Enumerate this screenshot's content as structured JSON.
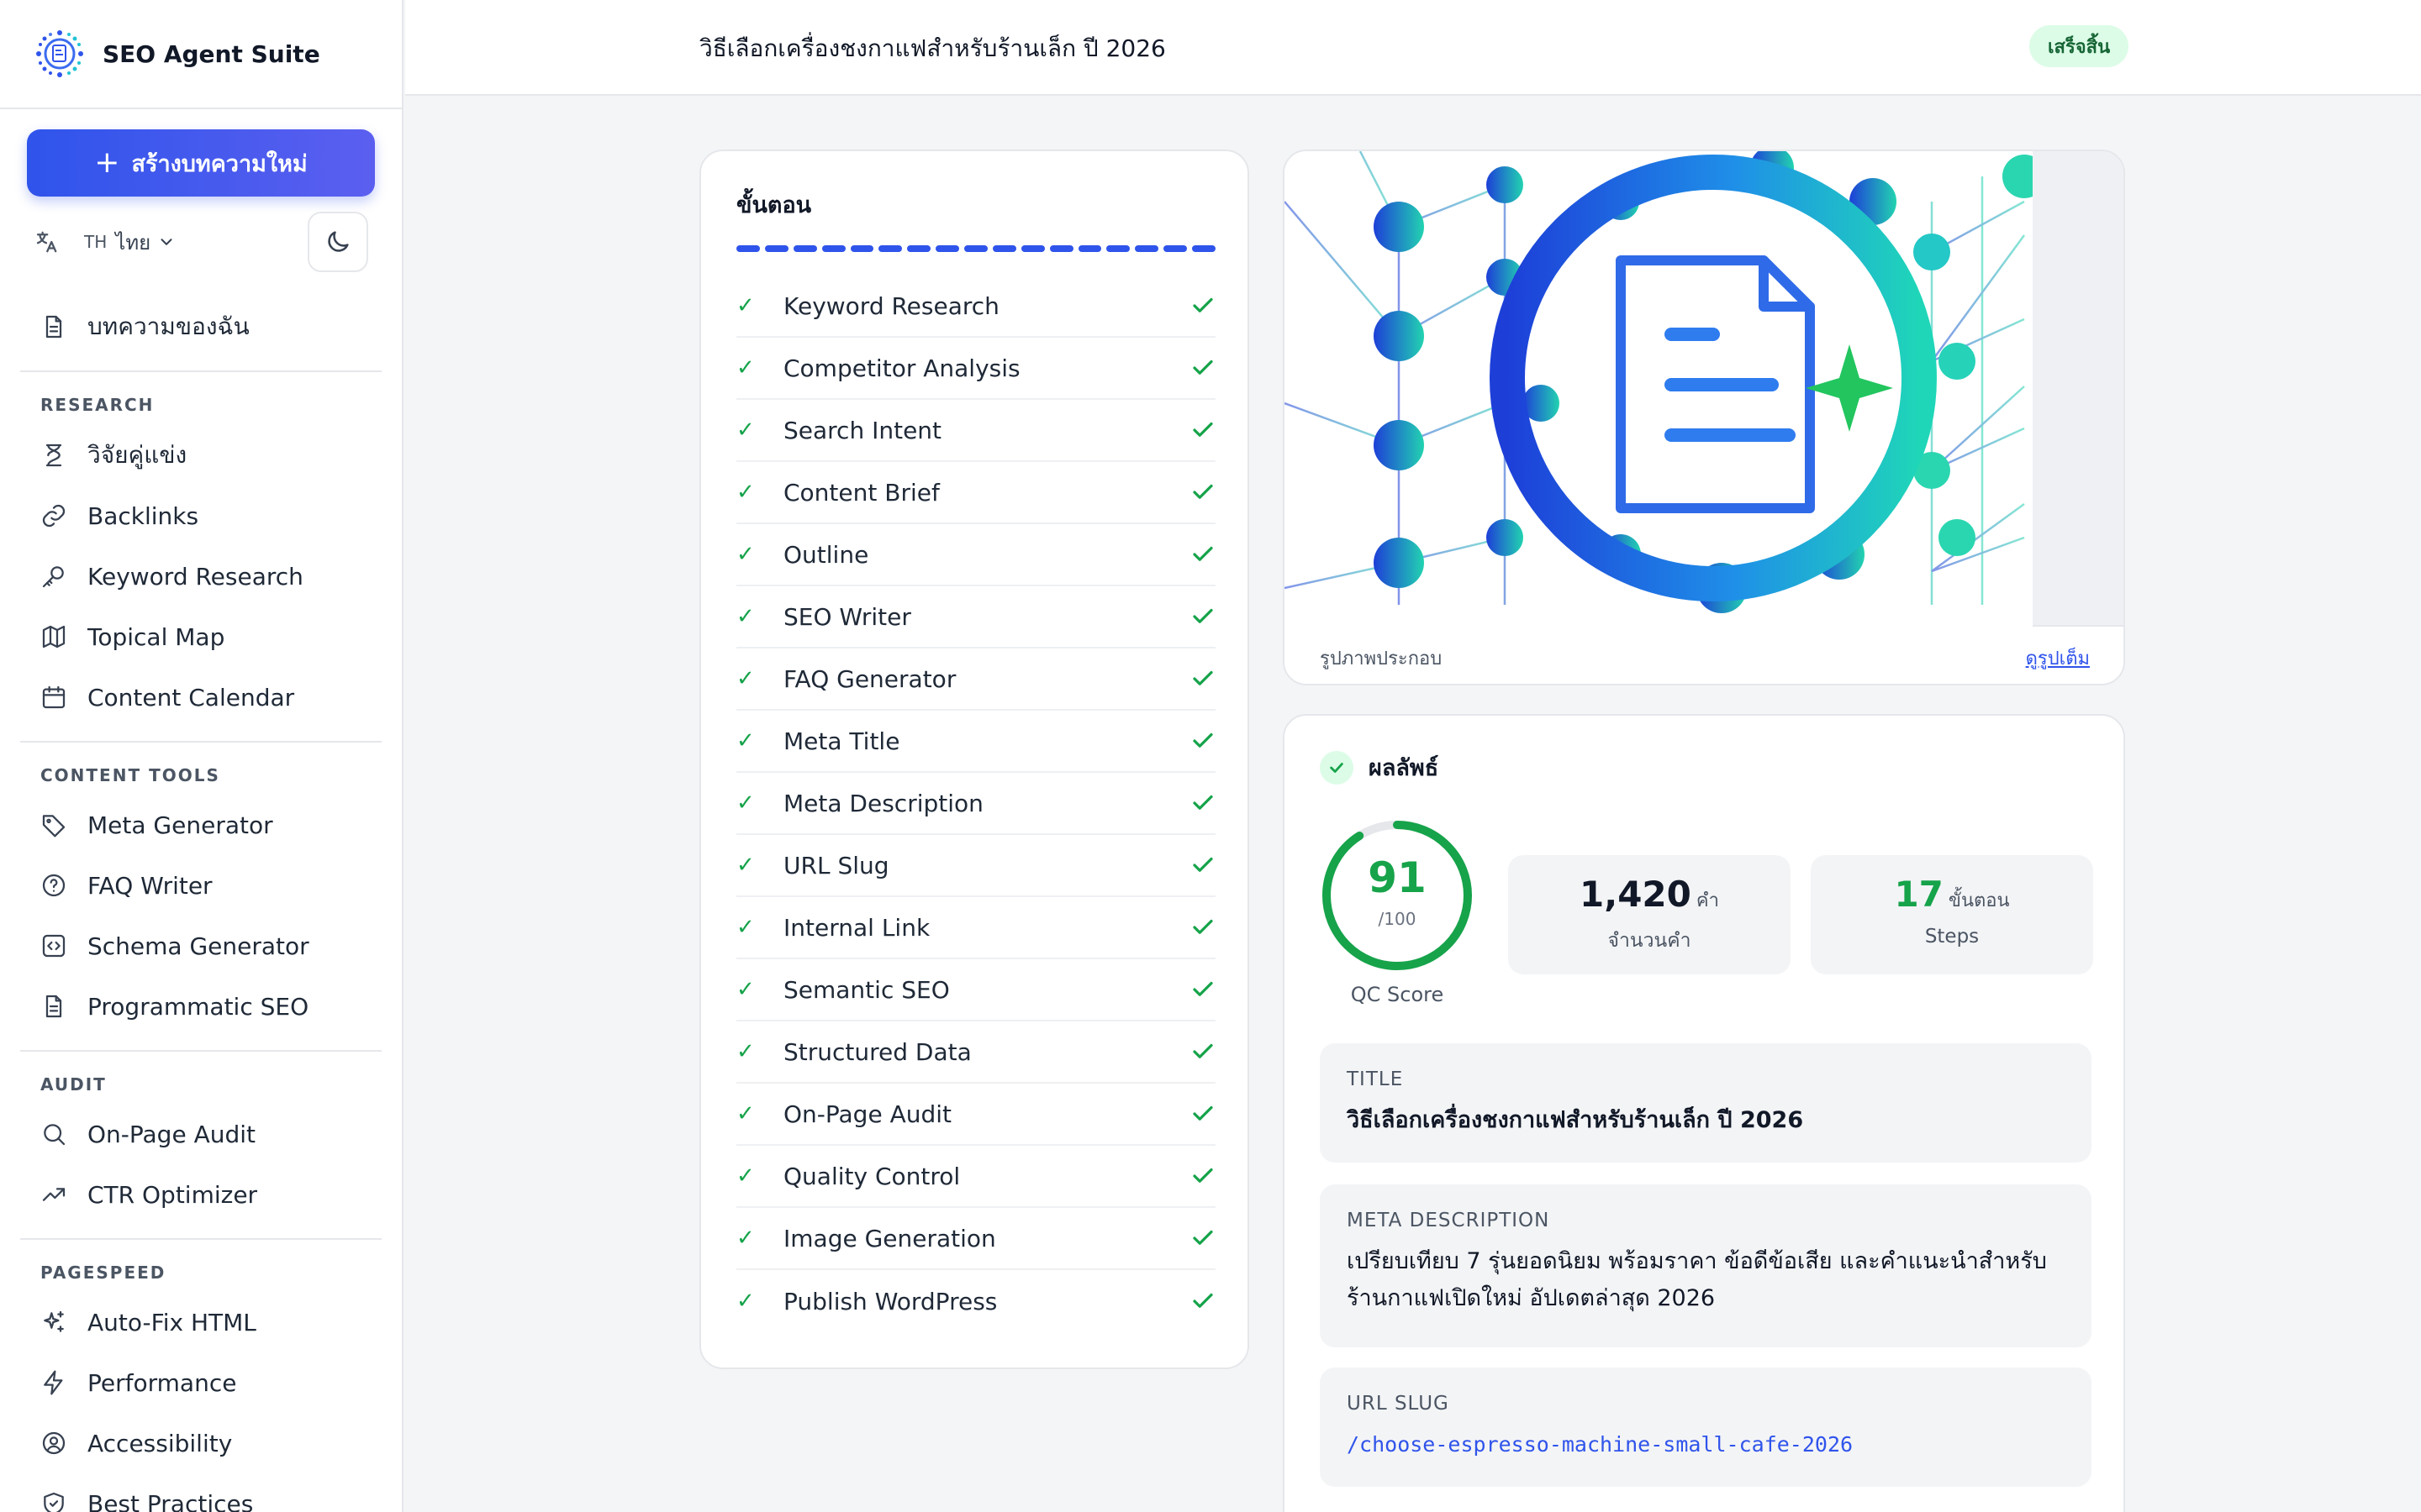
{
  "app": {
    "name": "SEO Agent Suite"
  },
  "sidebar": {
    "new_article": "สร้างบทความใหม่",
    "lang_code": "TH",
    "lang_name": "ไทย",
    "my_articles": "บทความของฉัน",
    "sections": [
      {
        "label": "RESEARCH",
        "items": [
          "วิจัยคู่แข่ง",
          "Backlinks",
          "Keyword Research",
          "Topical Map",
          "Content Calendar"
        ]
      },
      {
        "label": "CONTENT TOOLS",
        "items": [
          "Meta Generator",
          "FAQ Writer",
          "Schema Generator",
          "Programmatic SEO"
        ]
      },
      {
        "label": "AUDIT",
        "items": [
          "On-Page Audit",
          "CTR Optimizer"
        ]
      },
      {
        "label": "PAGESPEED",
        "items": [
          "Auto-Fix HTML",
          "Performance",
          "Accessibility",
          "Best Practices"
        ]
      }
    ]
  },
  "header": {
    "title": "วิธีเลือกเครื่องชงกาแฟสำหรับร้านเล็ก ปี 2026",
    "status": "เสร็จสิ้น"
  },
  "steps": {
    "title": "ขั้นตอน",
    "items": [
      "Keyword Research",
      "Competitor Analysis",
      "Search Intent",
      "Content Brief",
      "Outline",
      "SEO Writer",
      "FAQ Generator",
      "Meta Title",
      "Meta Description",
      "URL Slug",
      "Internal Link",
      "Semantic SEO",
      "Structured Data",
      "On-Page Audit",
      "Quality Control",
      "Image Generation",
      "Publish WordPress"
    ],
    "tick": "✓"
  },
  "image": {
    "caption": "รูปภาพประกอบ",
    "view_full": "ดูรูปเต็ม"
  },
  "result": {
    "title": "ผลลัพธ์",
    "score": "91",
    "score_fraction": 0.91,
    "score_max": "/100",
    "score_label": "QC Score",
    "words_value": "1,420",
    "words_unit": "คำ",
    "words_label": "จำนวนคำ",
    "steps_value": "17",
    "steps_unit": "ขั้นตอน",
    "steps_label": "Steps",
    "title_label": "TITLE",
    "title_value": "วิธีเลือกเครื่องชงกาแฟสำหรับร้านเล็ก ปี 2026",
    "meta_label": "META DESCRIPTION",
    "meta_value": "เปรียบเทียบ 7 รุ่นยอดนิยม พร้อมราคา ข้อดีข้อเสีย และคำแนะนำสำหรับร้านกาแฟเปิดใหม่ อัปเดตล่าสุด 2026",
    "slug_label": "URL SLUG",
    "slug_value": "/choose-espresso-machine-small-cafe-2026"
  },
  "colors": {
    "accent": "#2f54eb",
    "success": "#16a34a",
    "success_bg": "#dcfce7"
  }
}
